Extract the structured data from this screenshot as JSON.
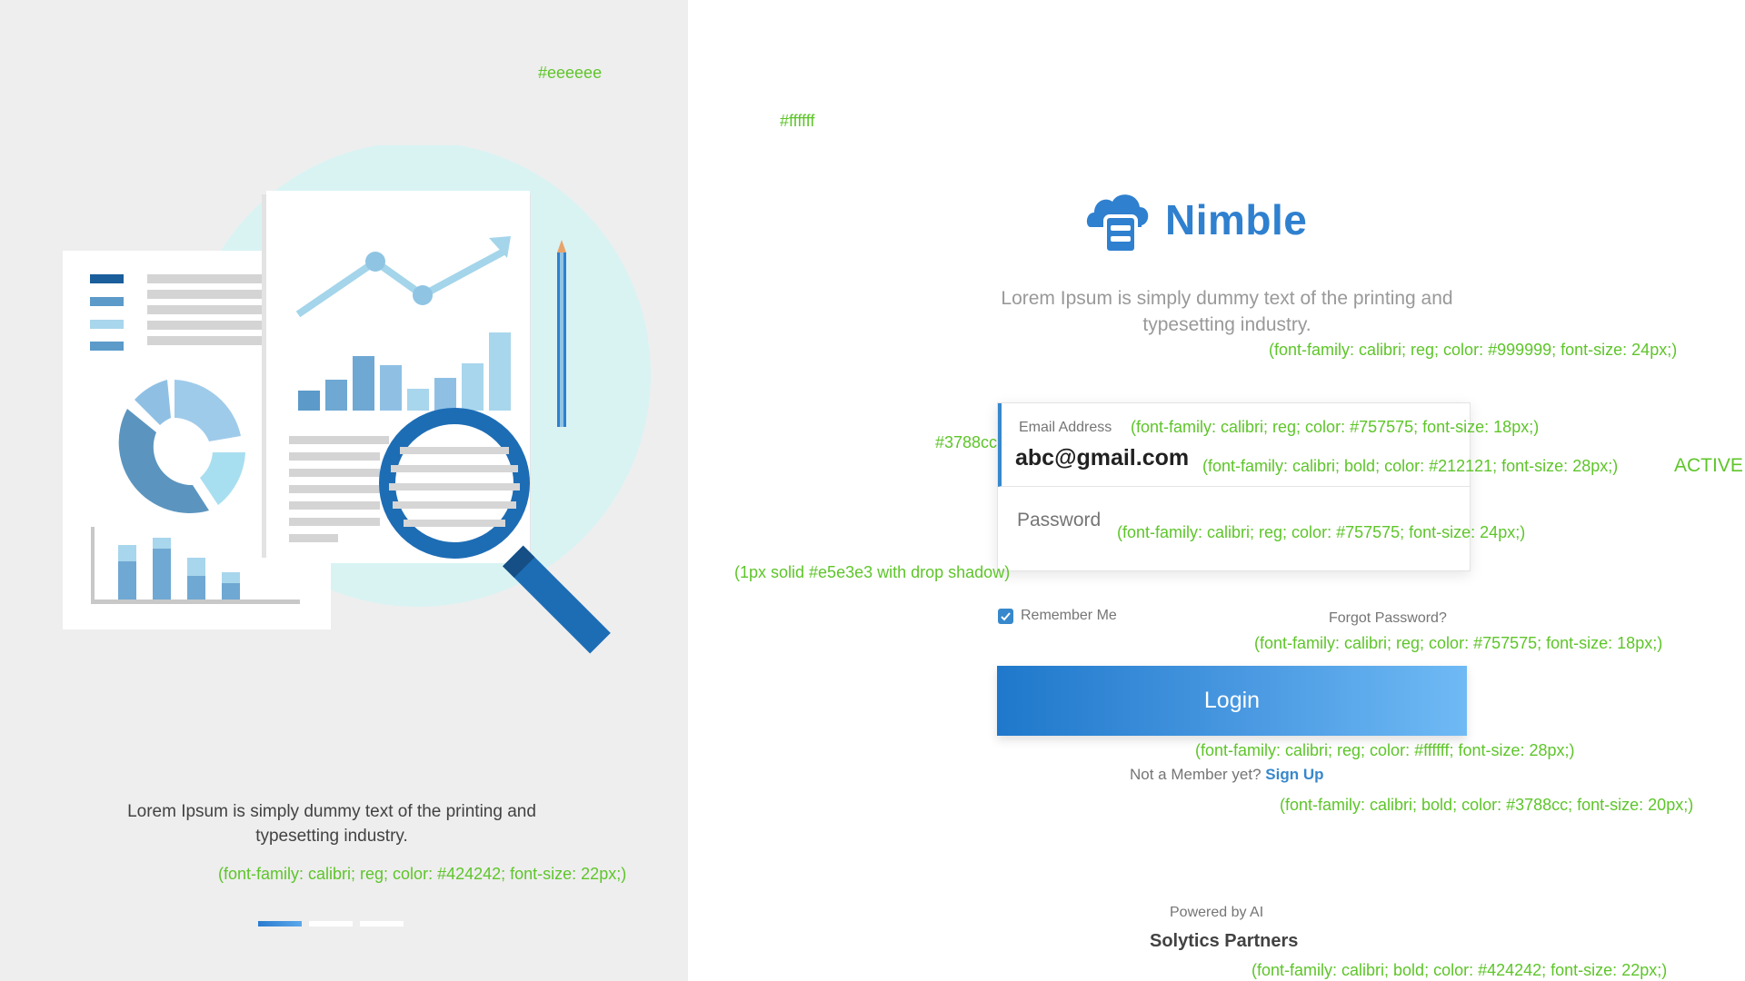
{
  "colors": {
    "left_bg": "#eeeeee",
    "right_bg": "#ffffff",
    "accent": "#3788cc",
    "annotation": "#5ec52a"
  },
  "left_panel": {
    "bg_note": "#eeeeee",
    "caption": "Lorem Ipsum is simply dummy text of the printing and typesetting industry.",
    "caption_note": "(font-family: calibri; reg; color: #424242; font-size: 22px;)",
    "carousel": {
      "count": 3,
      "active_index": 0
    }
  },
  "right_panel": {
    "bg_note": "#ffffff",
    "logo": {
      "icon": "cloud-server-icon",
      "name": "Nimble"
    },
    "tagline": "Lorem Ipsum is simply dummy text of the printing and typesetting industry.",
    "tagline_note": "(font-family: calibri; reg; color: #999999; font-size: 24px;)",
    "form": {
      "accent_note": "#3788cc",
      "card_note": "(1px solid #e5e3e3 with drop shadow)",
      "email_label": "Email Address",
      "email_label_note": "(font-family: calibri; reg; color: #757575; font-size: 18px;)",
      "email_value": "abc@gmail.com",
      "email_value_note": "(font-family: calibri; bold; color: #212121; font-size: 28px;)",
      "active_note": "ACTIVE",
      "password_placeholder": "Password",
      "password_note": "(font-family: calibri; reg; color: #757575; font-size: 24px;)",
      "remember_label": "Remember Me",
      "remember_checked": true,
      "forgot_label": "Forgot Password?",
      "forgot_note": "(font-family: calibri; reg; color: #757575; font-size: 18px;)",
      "login_label": "Login",
      "login_note": "(font-family: calibri; reg; color: #ffffff; font-size: 28px;)",
      "signup_prompt": "Not a Member yet?",
      "signup_link": "Sign Up",
      "signup_note": "(font-family: calibri; bold; color: #3788cc; font-size: 20px;)"
    },
    "footer": {
      "powered": "Powered by AI",
      "brand": "Solytics Partners",
      "brand_note": "(font-family: calibri; bold; color: #424242; font-size: 22px;)"
    }
  }
}
